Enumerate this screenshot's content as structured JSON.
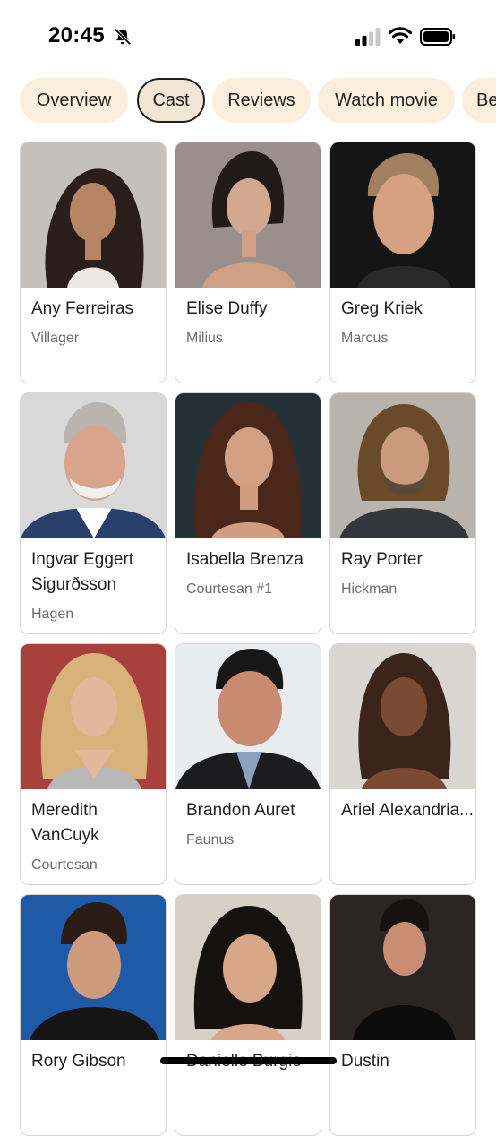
{
  "status_bar": {
    "time": "20:45",
    "icons": [
      "bell-off-icon",
      "cellular-signal-icon",
      "wifi-icon",
      "battery-icon"
    ]
  },
  "chips": [
    {
      "label": "Overview",
      "selected": false
    },
    {
      "label": "Cast",
      "selected": true
    },
    {
      "label": "Reviews",
      "selected": false
    },
    {
      "label": "Watch movie",
      "selected": false
    },
    {
      "label": "Be",
      "selected": false
    }
  ],
  "cast": [
    {
      "name": "Any Ferreiras",
      "role": "Villager"
    },
    {
      "name": "Elise Duffy",
      "role": "Milius"
    },
    {
      "name": "Greg Kriek",
      "role": "Marcus"
    },
    {
      "name": "Ingvar Eggert Sigurðsson",
      "role": "Hagen"
    },
    {
      "name": "Isabella Brenza",
      "role": "Courtesan #1"
    },
    {
      "name": "Ray Porter",
      "role": "Hickman"
    },
    {
      "name": "Meredith VanCuyk",
      "role": "Courtesan"
    },
    {
      "name": "Brandon Auret",
      "role": "Faunus"
    },
    {
      "name": "Ariel Alexandria...",
      "role": ""
    },
    {
      "name": "Rory Gibson",
      "role": ""
    },
    {
      "name": "Danielle Burgio",
      "role": ""
    },
    {
      "name": "Dustin",
      "role": ""
    }
  ],
  "colors": {
    "chip_bg": "#fbeedd",
    "chip_selected_border": "#1f1f1f",
    "card_border": "#d6d6d6",
    "role_text": "#6b6b6b"
  }
}
